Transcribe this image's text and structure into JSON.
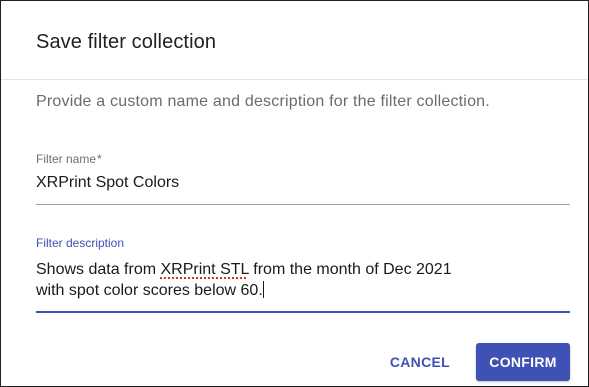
{
  "dialog": {
    "title": "Save filter collection",
    "description": "Provide a custom name and description for the filter collection."
  },
  "fields": {
    "name": {
      "label": "Filter name",
      "required_mark": "*",
      "value": "XRPrint Spot Colors"
    },
    "description": {
      "label": "Filter description",
      "value_line1_part1": "Shows data from ",
      "value_line1_misspelled": "XRPrint STL",
      "value_line1_part2": " from the month of Dec 2021",
      "value_line2": "with spot color scores below 60."
    }
  },
  "actions": {
    "cancel_label": "CANCEL",
    "confirm_label": "CONFIRM"
  },
  "colors": {
    "accent": "#3f51b5",
    "spellcheck": "#d93025"
  }
}
